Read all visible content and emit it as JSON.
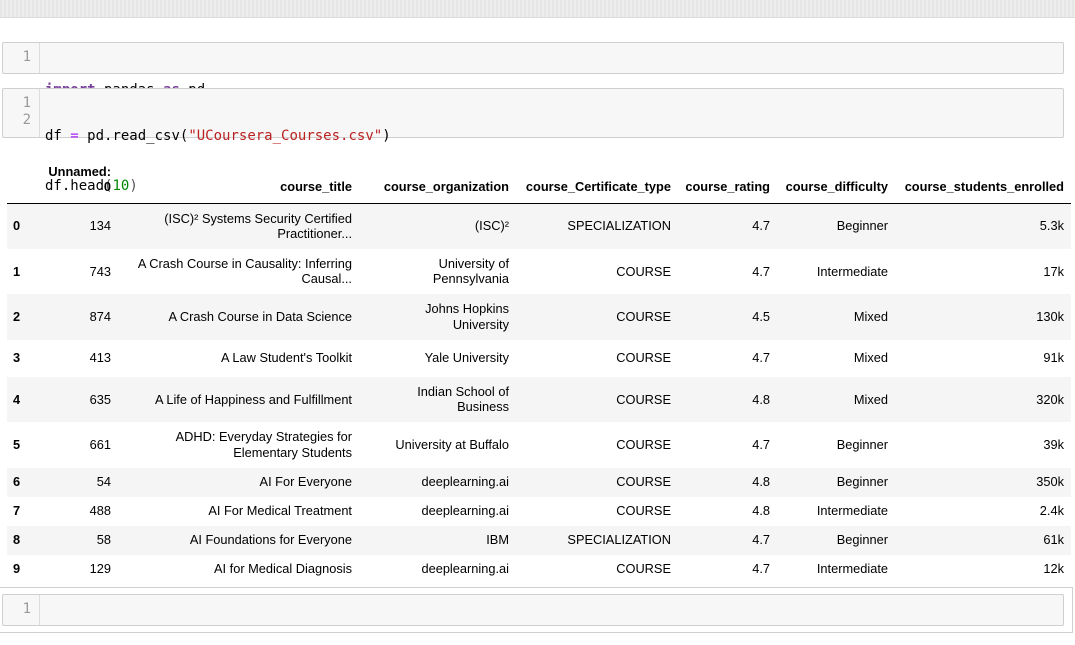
{
  "cells": [
    {
      "lines": [
        "1"
      ],
      "code": [
        "import pandas as pd"
      ]
    },
    {
      "lines": [
        "1",
        "2"
      ],
      "code": [
        "df = pd.read_csv(\"UCoursera_Courses.csv\")",
        "df.head(10)"
      ]
    },
    {
      "lines": [
        "1"
      ],
      "code": [
        ""
      ]
    }
  ],
  "table": {
    "columns": [
      "Unnamed: 0",
      "course_title",
      "course_organization",
      "course_Certificate_type",
      "course_rating",
      "course_difficulty",
      "course_students_enrolled"
    ],
    "rows": [
      {
        "index": "0",
        "unnamed": "134",
        "title": "(ISC)² Systems Security Certified Practitioner...",
        "org": "(ISC)²",
        "cert": "SPECIALIZATION",
        "rating": "4.7",
        "difficulty": "Beginner",
        "enrolled": "5.3k"
      },
      {
        "index": "1",
        "unnamed": "743",
        "title": "A Crash Course in Causality: Inferring Causal...",
        "org": "University of Pennsylvania",
        "cert": "COURSE",
        "rating": "4.7",
        "difficulty": "Intermediate",
        "enrolled": "17k"
      },
      {
        "index": "2",
        "unnamed": "874",
        "title": "A Crash Course in Data Science",
        "org": "Johns Hopkins University",
        "cert": "COURSE",
        "rating": "4.5",
        "difficulty": "Mixed",
        "enrolled": "130k"
      },
      {
        "index": "3",
        "unnamed": "413",
        "title": "A Law Student's Toolkit",
        "org": "Yale University",
        "cert": "COURSE",
        "rating": "4.7",
        "difficulty": "Mixed",
        "enrolled": "91k"
      },
      {
        "index": "4",
        "unnamed": "635",
        "title": "A Life of Happiness and Fulfillment",
        "org": "Indian School of Business",
        "cert": "COURSE",
        "rating": "4.8",
        "difficulty": "Mixed",
        "enrolled": "320k"
      },
      {
        "index": "5",
        "unnamed": "661",
        "title": "ADHD: Everyday Strategies for Elementary Students",
        "org": "University at Buffalo",
        "cert": "COURSE",
        "rating": "4.7",
        "difficulty": "Beginner",
        "enrolled": "39k"
      },
      {
        "index": "6",
        "unnamed": "54",
        "title": "AI For Everyone",
        "org": "deeplearning.ai",
        "cert": "COURSE",
        "rating": "4.8",
        "difficulty": "Beginner",
        "enrolled": "350k"
      },
      {
        "index": "7",
        "unnamed": "488",
        "title": "AI For Medical Treatment",
        "org": "deeplearning.ai",
        "cert": "COURSE",
        "rating": "4.8",
        "difficulty": "Intermediate",
        "enrolled": "2.4k"
      },
      {
        "index": "8",
        "unnamed": "58",
        "title": "AI Foundations for Everyone",
        "org": "IBM",
        "cert": "SPECIALIZATION",
        "rating": "4.7",
        "difficulty": "Beginner",
        "enrolled": "61k"
      },
      {
        "index": "9",
        "unnamed": "129",
        "title": "AI for Medical Diagnosis",
        "org": "deeplearning.ai",
        "cert": "COURSE",
        "rating": "4.7",
        "difficulty": "Intermediate",
        "enrolled": "12k"
      }
    ]
  }
}
